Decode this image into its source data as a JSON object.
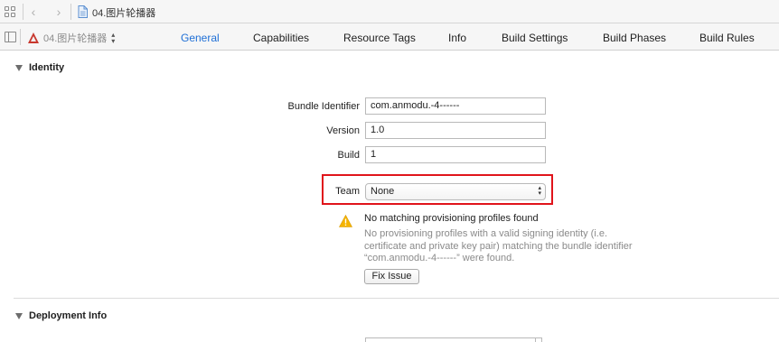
{
  "jumpbar": {
    "title": "04.图片轮播器",
    "icons": [
      "grid-icon",
      "back-arrow-icon",
      "forward-arrow-icon",
      "file-icon"
    ]
  },
  "tabbar": {
    "target_name": "04.图片轮播器",
    "tabs": [
      "General",
      "Capabilities",
      "Resource Tags",
      "Info",
      "Build Settings",
      "Build Phases",
      "Build Rules"
    ],
    "active_tab": "General"
  },
  "identity": {
    "header": "Identity",
    "bundle_identifier_label": "Bundle Identifier",
    "bundle_identifier_value": "com.anmodu.-4------",
    "version_label": "Version",
    "version_value": "1.0",
    "build_label": "Build",
    "build_value": "1",
    "team_label": "Team",
    "team_value": "None"
  },
  "warning": {
    "title": "No matching provisioning profiles found",
    "line1": "No provisioning profiles with a valid signing identity (i.e.",
    "line2": "certificate and private key pair) matching the bundle identifier",
    "line3": "“com.anmodu.-4------” were found.",
    "fix_button": "Fix Issue"
  },
  "deployment": {
    "header": "Deployment Info"
  },
  "colors": {
    "accent": "#1f6fd6",
    "highlight_border": "#e0141b",
    "warning_yellow": "#f5b400"
  }
}
